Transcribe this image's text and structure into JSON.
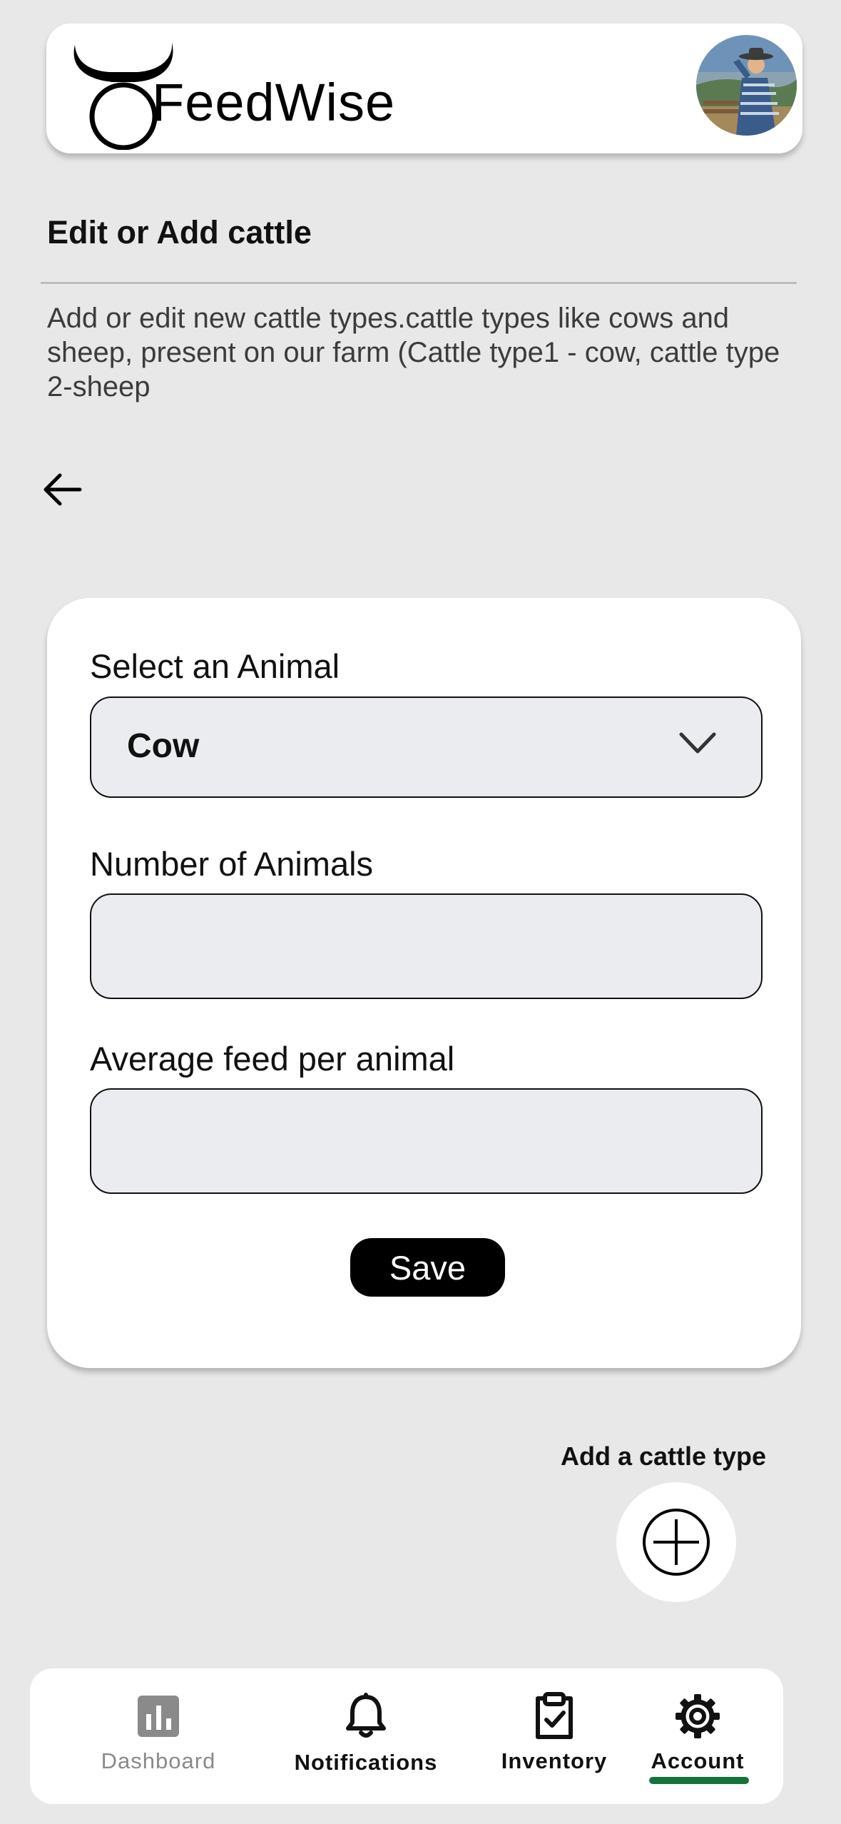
{
  "app": {
    "name": "FeedWise"
  },
  "header": {
    "logo_text": "FeedWise"
  },
  "page": {
    "title": "Edit or Add cattle",
    "description": "Add or edit new cattle types.cattle types like cows and sheep, present on our farm (Cattle type1 - cow, cattle type 2-sheep"
  },
  "form": {
    "animal_label": "Select an Animal",
    "animal_value": "Cow",
    "count_label": "Number of Animals",
    "count_value": "",
    "feed_label": "Average feed per animal",
    "feed_value": "",
    "save_label": "Save"
  },
  "add_cattle": {
    "label": "Add a  cattle type",
    "icon": "plus-circle-icon"
  },
  "nav": {
    "items": [
      {
        "label": "Dashboard",
        "icon": "bar-chart-icon",
        "color": "#8a8a8a"
      },
      {
        "label": "Notifications",
        "icon": "bell-icon",
        "color": "#111111"
      },
      {
        "label": "Inventory",
        "icon": "clipboard-check-icon",
        "color": "#111111"
      },
      {
        "label": "Account",
        "icon": "gear-icon",
        "color": "#111111",
        "active": true
      }
    ],
    "active_color": "#16723a"
  }
}
